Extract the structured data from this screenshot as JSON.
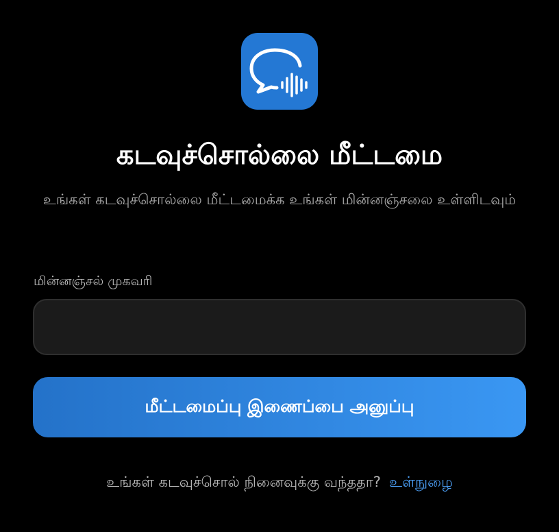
{
  "app": {
    "logo_icon": "chat-bubble-voice-icon",
    "accent_color": "#2478d4"
  },
  "header": {
    "title": "கடவுச்சொல்லை மீட்டமை",
    "subtitle": "உங்கள் கடவுச்சொல்லை மீட்டமைக்க உங்கள் மின்னஞ்சலை உள்ளிடவும்"
  },
  "form": {
    "email_label": "மின்னஞ்சல் முகவரி",
    "email_value": "",
    "email_placeholder": "",
    "submit_label": "மீட்டமைப்பு இணைப்பை அனுப்பு"
  },
  "footer": {
    "prompt_text": "உங்கள் கடவுச்சொல் நினைவுக்கு வந்ததா?",
    "login_link_label": "உள்நுழை",
    "link_color": "#4a9bf0"
  }
}
